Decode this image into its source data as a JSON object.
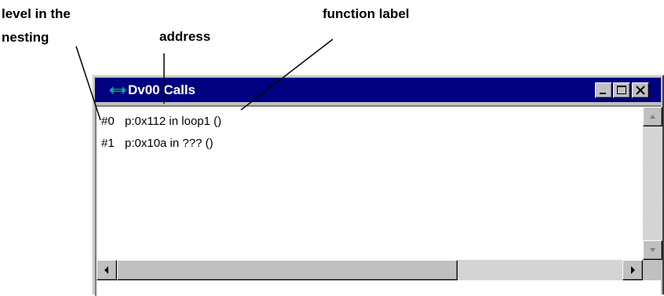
{
  "annotations": {
    "level_line1": "level in the",
    "level_line2": "nesting",
    "address": "address",
    "function": "function label"
  },
  "window": {
    "title": "Dv00 Calls",
    "icon": "debugger-app-icon",
    "buttons": {
      "minimize": "minimize-icon",
      "maximize": "maximize-icon",
      "close": "close-icon"
    }
  },
  "calls": [
    {
      "level": "#0",
      "text": "p:0x112 in loop1 ()"
    },
    {
      "level": "#1",
      "text": "p:0x10a in ??? ()"
    }
  ],
  "colors": {
    "titlebar": "#000080",
    "chrome": "#c0c0c0"
  }
}
